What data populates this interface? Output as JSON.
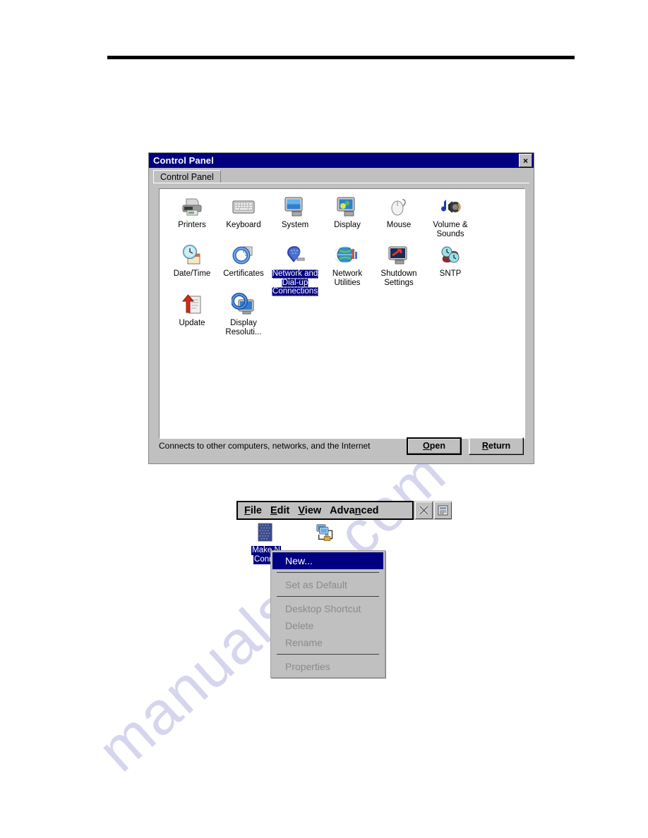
{
  "page": {
    "watermark_text": "manualslib.com"
  },
  "control_panel_window": {
    "title": "Control Panel",
    "close_label": "×",
    "tab_label": "Control Panel",
    "status_text": "Connects to other computers, networks, and the Internet",
    "buttons": [
      {
        "label": "Open",
        "accel": "O",
        "default": true
      },
      {
        "label": "Return",
        "accel": "R",
        "default": false
      }
    ],
    "icons": [
      {
        "label": "Printers",
        "icon": "printer-icon",
        "selected": false
      },
      {
        "label": "Keyboard",
        "icon": "keyboard-icon",
        "selected": false
      },
      {
        "label": "System",
        "icon": "system-monitor-icon",
        "selected": false
      },
      {
        "label": "Display",
        "icon": "display-monitor-icon",
        "selected": false
      },
      {
        "label": "Mouse",
        "icon": "mouse-icon",
        "selected": false
      },
      {
        "label": "Volume &\nSounds",
        "icon": "volume-sounds-icon",
        "selected": false
      },
      {
        "label": "Date/Time",
        "icon": "date-time-icon",
        "selected": false
      },
      {
        "label": "Certificates",
        "icon": "certificates-icon",
        "selected": false
      },
      {
        "label": "Network and\nDial-up\nConnections",
        "icon": "network-dialup-icon",
        "selected": true
      },
      {
        "label": "Network\nUtilities",
        "icon": "network-globe-icon",
        "selected": false
      },
      {
        "label": "Shutdown\nSettings",
        "icon": "shutdown-settings-icon",
        "selected": false
      },
      {
        "label": "SNTP",
        "icon": "sntp-clock-icon",
        "selected": false
      },
      {
        "label": "Update",
        "icon": "update-icon",
        "selected": false
      },
      {
        "label": "Display\nResoluti...",
        "icon": "display-resolution-icon",
        "selected": false
      }
    ]
  },
  "network_connections_window": {
    "menu_items": [
      {
        "label": "File",
        "accel_index": 0
      },
      {
        "label": "Edit",
        "accel_index": 0
      },
      {
        "label": "View",
        "accel_index": 0
      },
      {
        "label": "Advanced",
        "accel_index": 4
      }
    ],
    "toolbar_buttons": [
      {
        "icon": "cut-x-icon",
        "name": "delete-connection-button"
      },
      {
        "icon": "properties-icon",
        "name": "properties-button"
      }
    ],
    "items": [
      {
        "label": "Make N\nConne",
        "icon": "make-new-connection-icon",
        "selected": true
      },
      {
        "label": "",
        "icon": "network-connection-icon",
        "selected": false
      }
    ],
    "context_menu": [
      {
        "label": "New...",
        "enabled": true,
        "highlighted": true,
        "separator_after": true
      },
      {
        "label": "Set as Default",
        "enabled": false,
        "highlighted": false,
        "separator_after": true
      },
      {
        "label": "Desktop Shortcut",
        "enabled": false,
        "highlighted": false,
        "separator_after": false
      },
      {
        "label": "Delete",
        "enabled": false,
        "highlighted": false,
        "separator_after": false
      },
      {
        "label": "Rename",
        "enabled": false,
        "highlighted": false,
        "separator_after": true
      },
      {
        "label": "Properties",
        "enabled": false,
        "highlighted": false,
        "separator_after": false
      }
    ]
  },
  "colors": {
    "titlebar": "#000080",
    "window_face": "#c0c0c0",
    "selection": "#000080",
    "watermark": "#c8c8ea"
  }
}
